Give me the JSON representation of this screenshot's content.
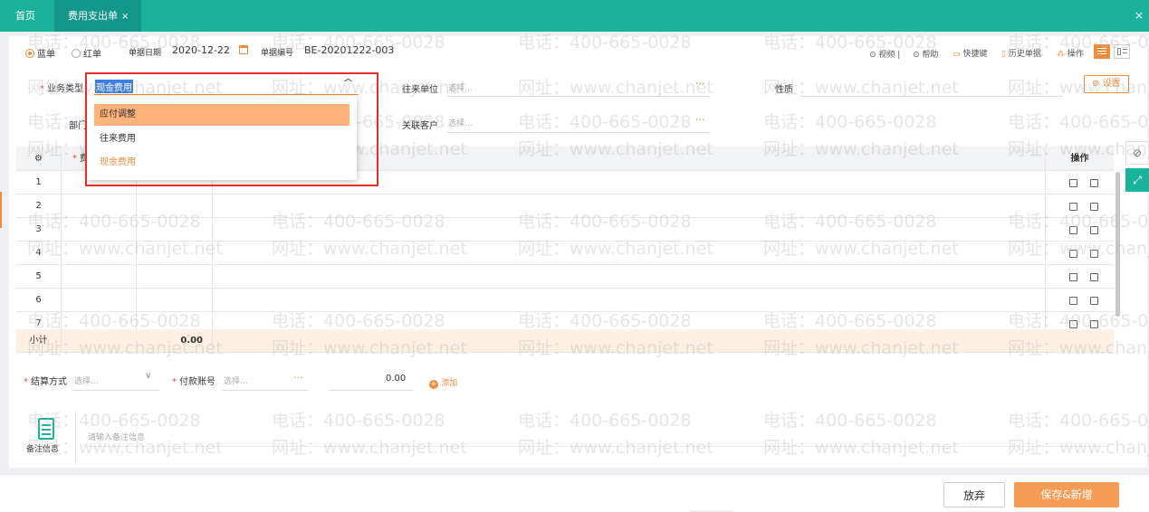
{
  "tabs": {
    "home": "首页",
    "active": "费用支出单",
    "active_close": "×",
    "window_close": "×"
  },
  "header": {
    "blue": "蓝单",
    "red": "红单",
    "date_label": "单据日期",
    "date_value": "2020-12-22",
    "code_label": "单据编号",
    "code_value": "BE-20201222-003",
    "video": "视频",
    "help": "帮助",
    "shortcut": "快捷键",
    "history": "历史单据",
    "operate": "操作"
  },
  "form": {
    "biz_type_label": "业务类型",
    "biz_type_value": "现金费用",
    "partner_label": "往来单位",
    "partner_placeholder": "选择...",
    "nature_label": "性质",
    "setting": "设置",
    "dept_label": "部门",
    "related_label": "关联客户",
    "related_placeholder": "选择...",
    "ellipsis": "···",
    "chevron": "^"
  },
  "dropdown": {
    "options": [
      "应付调整",
      "往来费用",
      "现金费用"
    ]
  },
  "grid": {
    "col_fee": "费用",
    "col_op": "操作",
    "rows": [
      "1",
      "2",
      "3",
      "4",
      "5",
      "6",
      "7"
    ],
    "subtotal_label": "小计",
    "subtotal_value": "0.00"
  },
  "settle": {
    "method_label": "结算方式",
    "method_placeholder": "选择...",
    "account_label": "付款账号",
    "account_placeholder": "选择...",
    "amount": "0.00",
    "add": "添加"
  },
  "remark": {
    "label": "备注信息",
    "placeholder": "请输入备注信息"
  },
  "footer": {
    "discard": "放弃",
    "save_new": "保存&新增"
  },
  "watermark": {
    "phone": "电话：400-665-0028",
    "site": "网址：www.chanjet.net"
  },
  "colors": {
    "teal": "#1bb29b",
    "orange": "#f08c3c",
    "highlight": "#ffb27a",
    "red_box": "#e52e2e"
  }
}
